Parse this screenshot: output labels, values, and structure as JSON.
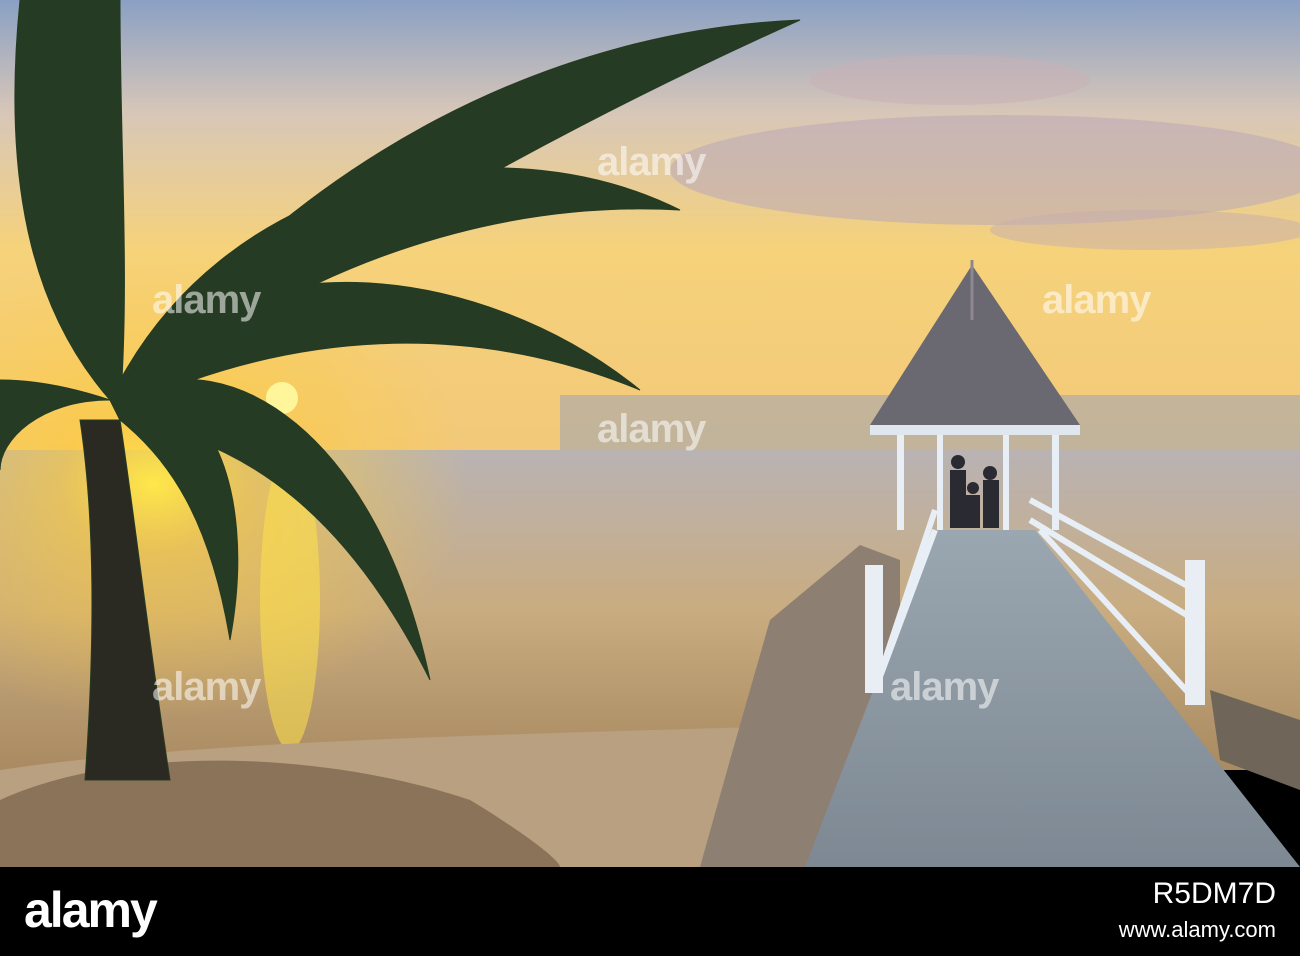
{
  "photo": {
    "description_tags": [
      "sunset",
      "palm-tree",
      "gazebo",
      "pier",
      "sea",
      "beach"
    ],
    "colors": {
      "sky_top": "#8fa3c2",
      "sun": "#ffd21a",
      "sea": "#c3a37a",
      "sand": "#cfb89a"
    }
  },
  "watermark": {
    "text": "alamy"
  },
  "footer": {
    "logo": "alamy",
    "image_id": "R5DM7D",
    "site": "www.alamy.com"
  }
}
